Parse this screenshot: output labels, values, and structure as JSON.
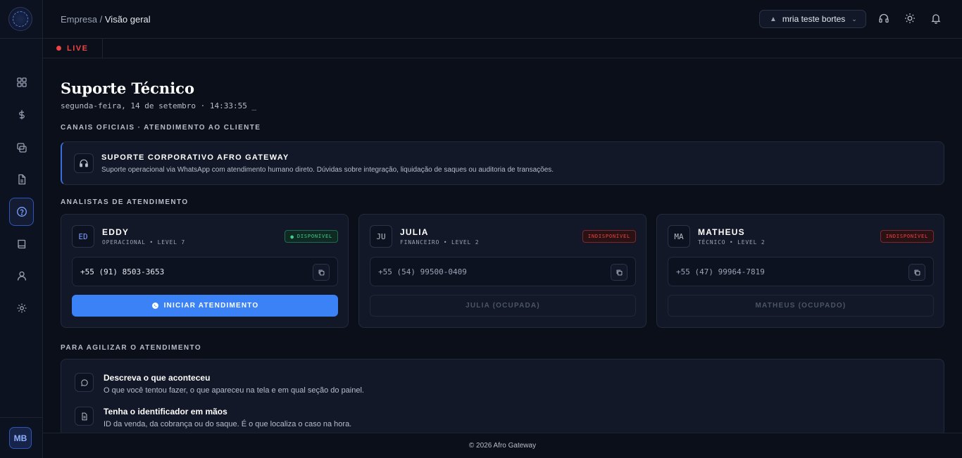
{
  "breadcrumb": {
    "parent": "Empresa",
    "separator": " / ",
    "current": "Visão geral"
  },
  "header": {
    "user_name": "mria teste bortes"
  },
  "live": {
    "label": "LIVE"
  },
  "sidebar": {
    "items": [
      {
        "icon": "grid-icon"
      },
      {
        "icon": "dollar-icon"
      },
      {
        "icon": "cards-icon"
      },
      {
        "icon": "document-icon"
      },
      {
        "icon": "help-icon",
        "active": true
      },
      {
        "icon": "book-icon"
      },
      {
        "icon": "user-icon"
      },
      {
        "icon": "gear-icon"
      }
    ],
    "avatar": "MB"
  },
  "page": {
    "title": "Suporte Técnico",
    "subtitle": "segunda-feira, 14 de setembro · 14:33:55 _"
  },
  "sections": {
    "channels": "CANAIS OFICIAIS · ATENDIMENTO AO CLIENTE",
    "analysts": "ANALISTAS DE ATENDIMENTO",
    "tips": "PARA AGILIZAR O ATENDIMENTO"
  },
  "banner": {
    "title": "SUPORTE CORPORATIVO AFRO GATEWAY",
    "text": "Suporte operacional via WhatsApp com atendimento humano direto. Dúvidas sobre integração, liquidação de saques ou auditoria de transações."
  },
  "analysts": [
    {
      "initials": "ED",
      "name": "EDDY",
      "role": "OPERACIONAL • LEVEL 7",
      "status": "DISPONÍVEL",
      "phone": "+55 (91) 8503-3653",
      "action": "INICIAR ATENDIMENTO",
      "available": true
    },
    {
      "initials": "JU",
      "name": "JULIA",
      "role": "FINANCEIRO • LEVEL 2",
      "status": "INDISPONÍVEL",
      "phone": "+55 (54) 99500-0409",
      "action": "JULIA (OCUPADA)",
      "available": false
    },
    {
      "initials": "MA",
      "name": "MATHEUS",
      "role": "TÉCNICO • LEVEL 2",
      "status": "INDISPONÍVEL",
      "phone": "+55 (47) 99964-7819",
      "action": "MATHEUS (OCUPADO)",
      "available": false
    }
  ],
  "tips": [
    {
      "icon": "chat-icon",
      "title": "Descreva o que aconteceu",
      "text": "O que você tentou fazer, o que apareceu na tela e em qual seção do painel."
    },
    {
      "icon": "file-icon",
      "title": "Tenha o identificador em mãos",
      "text": "ID da venda, da cobrança ou do saque. É o que localiza o caso na hora."
    }
  ],
  "footer": {
    "text": "© 2026 Afro Gateway"
  },
  "colors": {
    "accent": "#3b82f6",
    "live": "#ef4444",
    "available": "#3ecf8e",
    "background": "#0b0f19",
    "card": "#121827"
  }
}
